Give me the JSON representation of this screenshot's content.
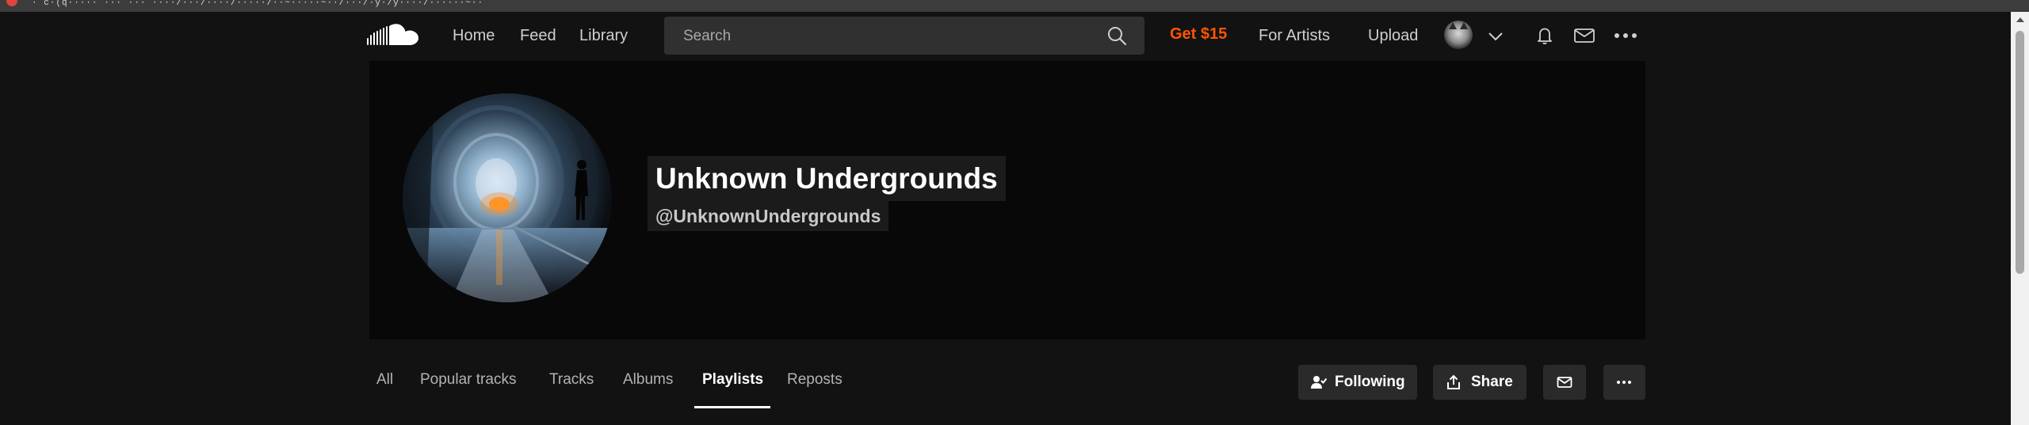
{
  "browser": {
    "url_fragment": "·  c·(q·····  ···  ···  ····/···/····/·····/··~·····~··/···/·y·/y····/······~··"
  },
  "header": {
    "logo_name": "soundcloud-logo",
    "nav": [
      {
        "label": "Home"
      },
      {
        "label": "Feed"
      },
      {
        "label": "Library"
      }
    ],
    "search": {
      "placeholder": "Search",
      "value": ""
    },
    "promo_label": "Get $15",
    "for_artists_label": "For Artists",
    "upload_label": "Upload",
    "accent_color": "#ff5500"
  },
  "profile": {
    "name": "Unknown Undergrounds",
    "handle": "@UnknownUndergrounds"
  },
  "tabs": [
    {
      "label": "All"
    },
    {
      "label": "Popular tracks"
    },
    {
      "label": "Tracks"
    },
    {
      "label": "Albums"
    },
    {
      "label": "Playlists",
      "active": true
    },
    {
      "label": "Reposts"
    }
  ],
  "actions": {
    "following_label": "Following",
    "share_label": "Share"
  }
}
